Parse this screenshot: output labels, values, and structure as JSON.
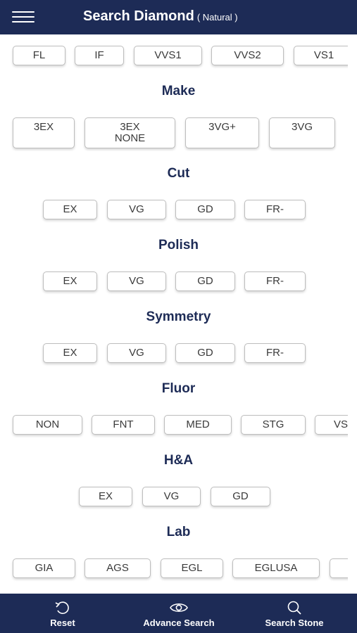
{
  "header": {
    "title": "Search Diamond",
    "subtitle": "( Natural )"
  },
  "clarity": [
    "FL",
    "IF",
    "VVS1",
    "VVS2",
    "VS1"
  ],
  "make": {
    "title": "Make",
    "options": [
      [
        "3EX"
      ],
      [
        "3EX",
        "NONE"
      ],
      [
        "3VG+"
      ],
      [
        "3VG"
      ]
    ]
  },
  "cut": {
    "title": "Cut",
    "options": [
      "EX",
      "VG",
      "GD",
      "FR-"
    ]
  },
  "polish": {
    "title": "Polish",
    "options": [
      "EX",
      "VG",
      "GD",
      "FR-"
    ]
  },
  "symmetry": {
    "title": "Symmetry",
    "options": [
      "EX",
      "VG",
      "GD",
      "FR-"
    ]
  },
  "fluor": {
    "title": "Fluor",
    "options": [
      "NON",
      "FNT",
      "MED",
      "STG",
      "VS"
    ]
  },
  "ha": {
    "title": "H&A",
    "options": [
      "EX",
      "VG",
      "GD"
    ]
  },
  "lab": {
    "title": "Lab",
    "options": [
      "GIA",
      "AGS",
      "EGL",
      "EGLUSA",
      ""
    ]
  },
  "footer": {
    "reset_label": "Reset",
    "reset_icon": "reset-icon",
    "advance_label": "Advance Search",
    "advance_icon": "eye-icon",
    "search_label": "Search Stone",
    "search_icon": "search-icon"
  },
  "colors": {
    "primary": "#1d2b56",
    "background": "#ffffff",
    "chip_border": "#bdbdbd"
  }
}
